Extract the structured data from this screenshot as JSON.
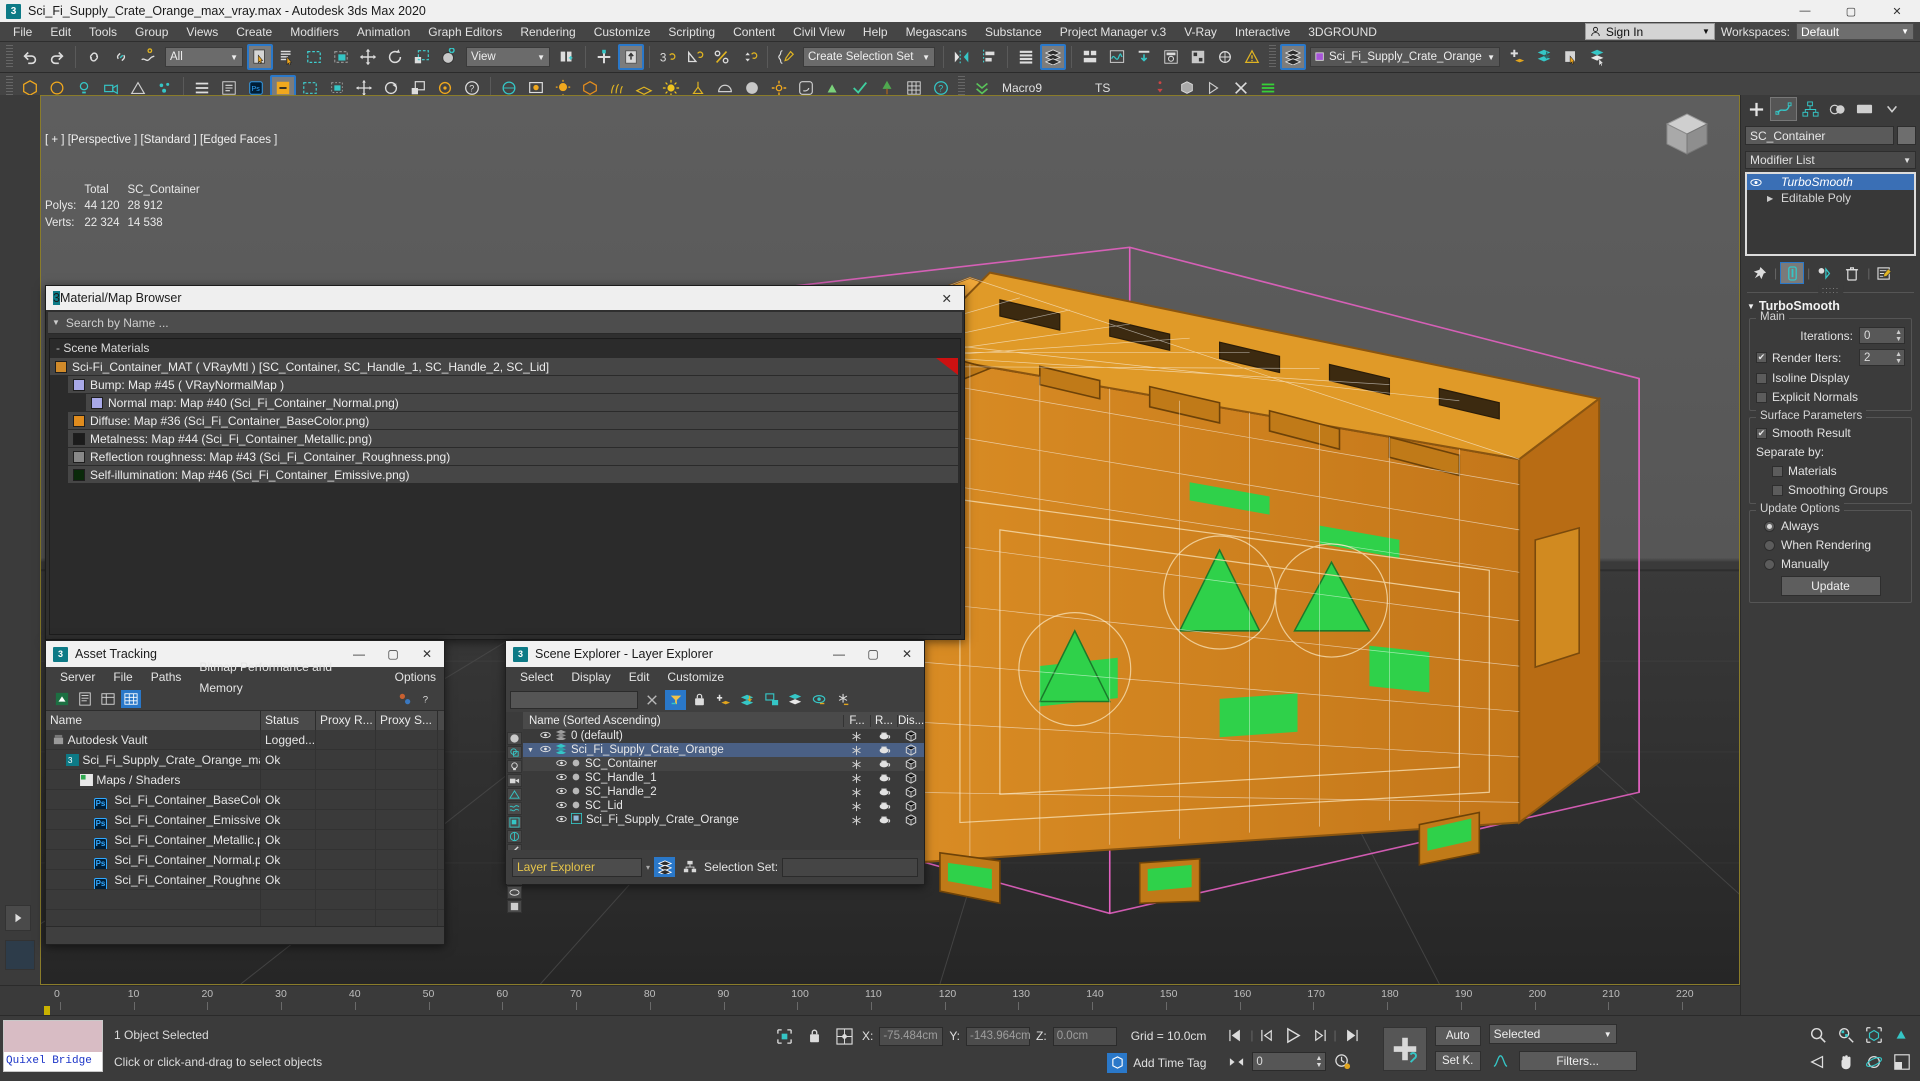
{
  "window": {
    "title": "Sci_Fi_Supply_Crate_Orange_max_vray.max - Autodesk 3ds Max 2020",
    "app_icon": "3",
    "minimize": "—",
    "maximize": "▢",
    "close": "✕"
  },
  "menubar": {
    "items": [
      "File",
      "Edit",
      "Tools",
      "Group",
      "Views",
      "Create",
      "Modifiers",
      "Animation",
      "Graph Editors",
      "Rendering",
      "Customize",
      "Scripting",
      "Content",
      "Civil View",
      "Help",
      "Megascans",
      "Substance",
      "Project Manager v.3",
      "V-Ray",
      "Interactive",
      "3DGROUND"
    ],
    "sign_in": "Sign In",
    "workspaces_label": "Workspaces:",
    "workspace_value": "Default"
  },
  "toolbar": {
    "selection_filter": "All",
    "ref_coord_system": "View",
    "selection_set": "Create Selection Set",
    "layer_current": "Sci_Fi_Supply_Crate_Orange",
    "macro_label": "Macro9",
    "ts_label": "TS"
  },
  "viewport": {
    "label": "[ + ] [Perspective ] [Standard ] [Edged Faces ]",
    "stats_header_total": "Total",
    "stats_header_object": "SC_Container",
    "rows": [
      {
        "label": "Polys:",
        "total": "44 120",
        "object": "28 912"
      },
      {
        "label": "Verts:",
        "total": "22 324",
        "object": "14 538"
      }
    ]
  },
  "ruler": {
    "ticks": [
      "0",
      "10",
      "20",
      "30",
      "40",
      "50",
      "60",
      "70",
      "80",
      "90",
      "100",
      "110",
      "120",
      "130",
      "140",
      "150",
      "160",
      "170",
      "180",
      "190",
      "200",
      "210",
      "220"
    ]
  },
  "material_browser": {
    "title": "Material/Map Browser",
    "close": "✕",
    "search_placeholder": "Search by Name ...",
    "group_label": "Scene Materials",
    "rows": [
      {
        "indent": 0,
        "text": "Sci-Fi_Container_MAT  ( VRayMtl )  [SC_Container, SC_Handle_1, SC_Handle_2, SC_Lid]",
        "swatch": "#d08a2a",
        "flag": true
      },
      {
        "indent": 1,
        "text": "Bump: Map #45  ( VRayNormalMap )",
        "swatch": "#a9a9e8",
        "flag": false
      },
      {
        "indent": 2,
        "text": "Normal map: Map #40 (Sci_Fi_Container_Normal.png)",
        "swatch": "#a9a9e8",
        "flag": false
      },
      {
        "indent": 1,
        "text": "Diffuse: Map #36 (Sci_Fi_Container_BaseColor.png)",
        "swatch": "#e08c1e",
        "flag": false
      },
      {
        "indent": 1,
        "text": "Metalness: Map #44 (Sci_Fi_Container_Metallic.png)",
        "swatch": "#1c1c1c",
        "flag": false
      },
      {
        "indent": 1,
        "text": "Reflection roughness: Map #43 (Sci_Fi_Container_Roughness.png)",
        "swatch": "#888888",
        "flag": false
      },
      {
        "indent": 1,
        "text": "Self-illumination: Map #46 (Sci_Fi_Container_Emissive.png)",
        "swatch": "#0a2a0a",
        "flag": false
      }
    ]
  },
  "asset_tracking": {
    "title": "Asset Tracking",
    "menus": [
      "Server",
      "File",
      "Paths",
      "Bitmap Performance and Memory",
      "Options"
    ],
    "columns": [
      "Name",
      "Status",
      "Proxy R...",
      "Proxy S..."
    ],
    "rows": [
      {
        "indent": 0,
        "name": "Autodesk Vault",
        "status": "Logged...",
        "icon": "vault"
      },
      {
        "indent": 1,
        "name": "Sci_Fi_Supply_Crate_Orange_max_vray.max",
        "status": "Ok",
        "icon": "max"
      },
      {
        "indent": 2,
        "name": "Maps / Shaders",
        "status": "",
        "icon": "maps"
      },
      {
        "indent": 3,
        "name": "Sci_Fi_Container_BaseColor.png",
        "status": "Ok",
        "icon": "ps"
      },
      {
        "indent": 3,
        "name": "Sci_Fi_Container_Emissive.png",
        "status": "Ok",
        "icon": "ps"
      },
      {
        "indent": 3,
        "name": "Sci_Fi_Container_Metallic.png",
        "status": "Ok",
        "icon": "ps"
      },
      {
        "indent": 3,
        "name": "Sci_Fi_Container_Normal.png",
        "status": "Ok",
        "icon": "ps"
      },
      {
        "indent": 3,
        "name": "Sci_Fi_Container_Roughness.png",
        "status": "Ok",
        "icon": "ps"
      }
    ],
    "blank_rows": 7
  },
  "scene_explorer": {
    "title": "Scene Explorer - Layer Explorer",
    "menus": [
      "Select",
      "Display",
      "Edit",
      "Customize"
    ],
    "search_value": "",
    "columns": {
      "name": "Name (Sorted Ascending)",
      "f": "F...",
      "r": "R...",
      "dis": "Dis..."
    },
    "rows": [
      {
        "indent": 0,
        "name": "0 (default)",
        "kind": "layer",
        "selected": false,
        "expanded": false
      },
      {
        "indent": 0,
        "name": "Sci_Fi_Supply_Crate_Orange",
        "kind": "layer",
        "selected": true,
        "expanded": true
      },
      {
        "indent": 1,
        "name": "SC_Container",
        "kind": "object",
        "selected": false,
        "shaded": true
      },
      {
        "indent": 1,
        "name": "SC_Handle_1",
        "kind": "object",
        "selected": false,
        "shaded": false
      },
      {
        "indent": 1,
        "name": "SC_Handle_2",
        "kind": "object",
        "selected": false,
        "shaded": false
      },
      {
        "indent": 1,
        "name": "SC_Lid",
        "kind": "object",
        "selected": false,
        "shaded": false
      },
      {
        "indent": 1,
        "name": "Sci_Fi_Supply_Crate_Orange",
        "kind": "group",
        "selected": false,
        "shaded": false
      }
    ],
    "footer_explorer": "Layer Explorer",
    "footer_selset_label": "Selection Set:",
    "footer_selset_value": ""
  },
  "command_panel": {
    "object_name": "SC_Container",
    "modifier_list_label": "Modifier List",
    "stack": [
      {
        "name": "TurboSmooth",
        "selected": true,
        "italic": true
      },
      {
        "name": "Editable Poly",
        "selected": false,
        "italic": false
      }
    ],
    "rollout_title": "TurboSmooth",
    "main": {
      "group_label": "Main",
      "iterations_label": "Iterations:",
      "iterations_value": "0",
      "render_iters_label": "Render Iters:",
      "render_iters_value": "2",
      "render_iters_checked": true,
      "isoline_label": "Isoline Display",
      "isoline_checked": false,
      "explicit_label": "Explicit Normals",
      "explicit_checked": false
    },
    "surface": {
      "group_label": "Surface Parameters",
      "smooth_result_label": "Smooth Result",
      "smooth_result_checked": true,
      "separate_by_label": "Separate by:",
      "materials_label": "Materials",
      "materials_checked": false,
      "smoothing_groups_label": "Smoothing Groups",
      "smoothing_groups_checked": false
    },
    "update": {
      "group_label": "Update Options",
      "options": [
        {
          "label": "Always",
          "selected": true
        },
        {
          "label": "When Rendering",
          "selected": false
        },
        {
          "label": "Manually",
          "selected": false
        }
      ],
      "button": "Update"
    }
  },
  "statusbar": {
    "quixel_label": "Quixel Bridge",
    "selection_text": "1 Object Selected",
    "prompt_text": "Click or click-and-drag to select objects",
    "coords": {
      "x_label": "X:",
      "x_value": "-75.484cm",
      "y_label": "Y:",
      "y_value": "-143.964cm",
      "z_label": "Z:",
      "z_value": "0.0cm"
    },
    "grid_text": "Grid = 10.0cm",
    "add_time_tag": "Add Time Tag",
    "frame_value": "0",
    "auto_key": "Auto",
    "set_key": "Set K.",
    "key_filter_value": "Selected",
    "filters_button": "Filters..."
  },
  "colors": {
    "accent_blue": "#2a78c9",
    "crate_orange": "#e08c1e",
    "emissive_green": "#2fd14a",
    "selection_pink": "#e261c0",
    "title_light": "#f0f0f0",
    "panel_dark": "#3b3b3b"
  }
}
